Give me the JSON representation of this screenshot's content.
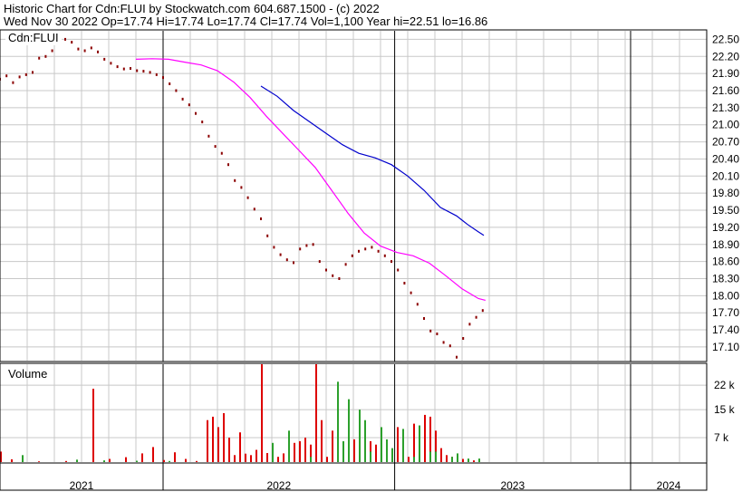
{
  "header": {
    "line1": "Historic Chart for Cdn:FLUI by Stockwatch.com 604.687.1500 - (c) 2022",
    "line2": "Wed Nov 30 2022   Op=17.74  Hi=17.74  Lo=17.74  Cl=17.74  Vol=1,100  Year hi=22.51  lo=16.86"
  },
  "colors": {
    "price": "#8b0000",
    "ma_short": "#ff00ff",
    "ma_long": "#0000cc",
    "volume_up": "#2ca02c",
    "volume_down": "#dd0000",
    "grid": "#c8c8c8"
  },
  "chart_data": [
    {
      "type": "scatter",
      "title": "Cdn:FLUI",
      "y_axis": {
        "min": 16.86,
        "max": 22.65,
        "ticks": [
          "22.50",
          "22.20",
          "21.90",
          "21.60",
          "21.30",
          "21.00",
          "20.70",
          "20.40",
          "20.10",
          "19.80",
          "19.50",
          "19.20",
          "18.90",
          "18.60",
          "18.30",
          "18.00",
          "17.70",
          "17.40",
          "17.10"
        ]
      },
      "x_axis": {
        "labels": [
          "2021",
          "2022",
          "2023",
          "2024"
        ]
      },
      "series": [
        {
          "role": "price",
          "points": [
            [
              0.0,
              21.8
            ],
            [
              1.2,
              21.86
            ],
            [
              2.4,
              21.74
            ],
            [
              3.6,
              21.84
            ],
            [
              4.8,
              21.88
            ],
            [
              6.0,
              21.92
            ],
            [
              7.2,
              22.17
            ],
            [
              8.4,
              22.2
            ],
            [
              9.6,
              22.3
            ],
            [
              10.8,
              22.42
            ],
            [
              12.0,
              22.5
            ],
            [
              13.2,
              22.45
            ],
            [
              14.4,
              22.33
            ],
            [
              15.6,
              22.3
            ],
            [
              16.8,
              22.35
            ],
            [
              18.0,
              22.28
            ],
            [
              19.2,
              22.15
            ],
            [
              20.4,
              22.08
            ],
            [
              21.6,
              22.02
            ],
            [
              22.8,
              21.98
            ],
            [
              24.0,
              21.99
            ],
            [
              25.2,
              21.95
            ],
            [
              26.4,
              21.94
            ],
            [
              27.6,
              21.92
            ],
            [
              28.8,
              21.88
            ],
            [
              30.0,
              21.83
            ],
            [
              31.2,
              21.72
            ],
            [
              32.4,
              21.6
            ],
            [
              33.6,
              21.45
            ],
            [
              34.8,
              21.35
            ],
            [
              36.0,
              21.2
            ],
            [
              37.2,
              21.05
            ],
            [
              38.4,
              20.8
            ],
            [
              39.6,
              20.62
            ],
            [
              40.8,
              20.5
            ],
            [
              42.0,
              20.3
            ],
            [
              43.2,
              20.02
            ],
            [
              44.4,
              19.9
            ],
            [
              45.6,
              19.72
            ],
            [
              46.8,
              19.52
            ],
            [
              48.0,
              19.35
            ],
            [
              49.2,
              19.05
            ],
            [
              50.4,
              18.85
            ],
            [
              51.6,
              18.72
            ],
            [
              52.8,
              18.63
            ],
            [
              54.0,
              18.58
            ],
            [
              55.2,
              18.82
            ],
            [
              56.4,
              18.88
            ],
            [
              57.6,
              18.9
            ],
            [
              58.8,
              18.6
            ],
            [
              60.0,
              18.45
            ],
            [
              61.2,
              18.35
            ],
            [
              62.4,
              18.3
            ],
            [
              63.6,
              18.55
            ],
            [
              64.8,
              18.7
            ],
            [
              66.0,
              18.78
            ],
            [
              67.2,
              18.82
            ],
            [
              68.4,
              18.85
            ],
            [
              69.6,
              18.78
            ],
            [
              70.8,
              18.7
            ],
            [
              72.0,
              18.6
            ],
            [
              73.2,
              18.45
            ],
            [
              74.4,
              18.22
            ],
            [
              75.6,
              18.05
            ],
            [
              76.8,
              17.85
            ],
            [
              78.0,
              17.6
            ],
            [
              79.2,
              17.38
            ],
            [
              80.4,
              17.33
            ],
            [
              81.6,
              17.18
            ],
            [
              82.8,
              17.12
            ],
            [
              84.0,
              16.92
            ],
            [
              85.2,
              17.25
            ],
            [
              86.4,
              17.5
            ],
            [
              87.6,
              17.62
            ],
            [
              88.8,
              17.74
            ]
          ]
        },
        {
          "role": "ma_short",
          "points": [
            [
              25.0,
              22.15
            ],
            [
              28.0,
              22.16
            ],
            [
              31.0,
              22.15
            ],
            [
              34.0,
              22.1
            ],
            [
              37.0,
              22.05
            ],
            [
              40.0,
              21.95
            ],
            [
              43.0,
              21.75
            ],
            [
              46.0,
              21.48
            ],
            [
              49.0,
              21.15
            ],
            [
              52.0,
              20.85
            ],
            [
              55.0,
              20.55
            ],
            [
              58.0,
              20.25
            ],
            [
              61.0,
              19.85
            ],
            [
              64.0,
              19.45
            ],
            [
              67.0,
              19.1
            ],
            [
              70.0,
              18.87
            ],
            [
              73.0,
              18.76
            ],
            [
              76.0,
              18.7
            ],
            [
              79.0,
              18.57
            ],
            [
              82.0,
              18.35
            ],
            [
              85.0,
              18.12
            ],
            [
              88.0,
              17.95
            ],
            [
              89.3,
              17.92
            ]
          ]
        },
        {
          "role": "ma_long",
          "points": [
            [
              48.0,
              21.68
            ],
            [
              51.0,
              21.5
            ],
            [
              54.0,
              21.25
            ],
            [
              57.0,
              21.05
            ],
            [
              60.0,
              20.85
            ],
            [
              63.0,
              20.65
            ],
            [
              66.0,
              20.5
            ],
            [
              69.0,
              20.42
            ],
            [
              72.0,
              20.3
            ],
            [
              75.0,
              20.1
            ],
            [
              78.0,
              19.85
            ],
            [
              81.0,
              19.55
            ],
            [
              84.0,
              19.4
            ],
            [
              86.0,
              19.25
            ],
            [
              88.0,
              19.12
            ],
            [
              89.0,
              19.06
            ]
          ]
        }
      ]
    },
    {
      "type": "bar",
      "title": "Volume",
      "y_axis": {
        "min": 0,
        "max": 28000,
        "ticks": [
          "22 k",
          "15 k",
          "7 k"
        ]
      },
      "x_axis": {
        "labels": [
          "2021",
          "2022",
          "2023",
          "2024"
        ]
      },
      "series": [
        {
          "role": "volume_down",
          "bars": [
            [
              0,
              3000
            ],
            [
              2,
              800
            ],
            [
              7,
              200
            ],
            [
              12,
              300
            ],
            [
              17,
              21000
            ],
            [
              20,
              900
            ],
            [
              23,
              1400
            ],
            [
              26,
              2500
            ],
            [
              28,
              4300
            ],
            [
              30,
              600
            ],
            [
              32,
              2800
            ],
            [
              34,
              900
            ],
            [
              36,
              300
            ],
            [
              38,
              12000
            ],
            [
              39,
              13000
            ],
            [
              40,
              10000
            ],
            [
              41,
              14000
            ],
            [
              42,
              7000
            ],
            [
              43,
              2000
            ],
            [
              44,
              8500
            ],
            [
              45,
              2400
            ],
            [
              46,
              2000
            ],
            [
              47,
              3500
            ],
            [
              48,
              29000
            ],
            [
              49,
              2600
            ],
            [
              50,
              4000
            ],
            [
              51,
              1500
            ],
            [
              52,
              2500
            ],
            [
              53,
              5000
            ],
            [
              54,
              5500
            ],
            [
              55,
              6000
            ],
            [
              56,
              7000
            ],
            [
              57,
              5000
            ],
            [
              58,
              29000
            ],
            [
              59,
              12000
            ],
            [
              60,
              1500
            ],
            [
              61,
              9000
            ],
            [
              62,
              7000
            ],
            [
              63,
              4000
            ],
            [
              64,
              5000
            ],
            [
              65,
              6500
            ],
            [
              66,
              7000
            ],
            [
              67,
              5500
            ],
            [
              68,
              6000
            ],
            [
              69,
              5000
            ],
            [
              70,
              4000
            ],
            [
              71,
              3000
            ],
            [
              72,
              2400
            ],
            [
              73,
              10000
            ],
            [
              74,
              2000
            ],
            [
              75,
              1500
            ],
            [
              76,
              11000
            ],
            [
              77,
              8000
            ],
            [
              78,
              13500
            ],
            [
              79,
              13000
            ],
            [
              80,
              9000
            ],
            [
              81,
              4000
            ],
            [
              82,
              2000
            ],
            [
              83,
              1500
            ],
            [
              84,
              1000
            ],
            [
              85,
              900
            ],
            [
              86,
              700
            ],
            [
              87,
              500
            ]
          ]
        },
        {
          "role": "volume_up",
          "bars": [
            [
              4,
              2000
            ],
            [
              14,
              700
            ],
            [
              19,
              500
            ],
            [
              25,
              400
            ],
            [
              31,
              300
            ],
            [
              50,
              5500
            ],
            [
              53,
              9000
            ],
            [
              57,
              1500
            ],
            [
              62,
              23000
            ],
            [
              63,
              6000
            ],
            [
              64,
              18000
            ],
            [
              66,
              15000
            ],
            [
              67,
              12000
            ],
            [
              68,
              3000
            ],
            [
              70,
              10000
            ],
            [
              71,
              6500
            ],
            [
              72,
              4000
            ],
            [
              74,
              9500
            ],
            [
              76,
              1500
            ],
            [
              77,
              10500
            ],
            [
              79,
              3000
            ],
            [
              80,
              3000
            ],
            [
              83,
              1500
            ],
            [
              84,
              2500
            ],
            [
              86,
              1000
            ],
            [
              88,
              1000
            ]
          ]
        }
      ]
    }
  ]
}
